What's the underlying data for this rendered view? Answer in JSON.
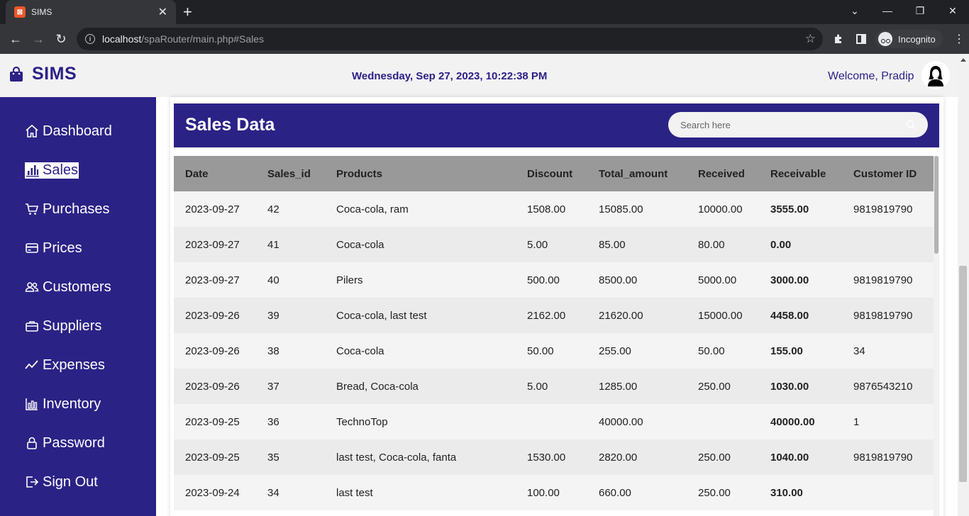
{
  "browser": {
    "tab_title": "SIMS",
    "url_host": "localhost",
    "url_path": "/spaRouter/main.php#Sales",
    "incognito_label": "Incognito"
  },
  "header": {
    "logo_text": "SIMS",
    "datetime": "Wednesday, Sep 27, 2023, 10:22:38 PM",
    "welcome": "Welcome, Pradip"
  },
  "sidebar": {
    "items": [
      {
        "label": "Dashboard",
        "icon": "home-icon"
      },
      {
        "label": "Sales",
        "icon": "bar-chart-icon"
      },
      {
        "label": "Purchases",
        "icon": "cart-icon"
      },
      {
        "label": "Prices",
        "icon": "credit-card-icon"
      },
      {
        "label": "Customers",
        "icon": "users-icon"
      },
      {
        "label": "Suppliers",
        "icon": "briefcase-icon"
      },
      {
        "label": "Expenses",
        "icon": "trend-line-icon"
      },
      {
        "label": "Inventory",
        "icon": "inventory-chart-icon"
      },
      {
        "label": "Password",
        "icon": "lock-icon"
      },
      {
        "label": "Sign Out",
        "icon": "sign-out-icon"
      }
    ]
  },
  "sales": {
    "title": "Sales Data",
    "search_placeholder": "Search here",
    "columns": [
      "Date",
      "Sales_id",
      "Products",
      "Discount",
      "Total_amount",
      "Received",
      "Receivable",
      "Customer ID"
    ],
    "rows": [
      [
        "2023-09-27",
        "42",
        "Coca-cola, ram",
        "1508.00",
        "15085.00",
        "10000.00",
        "3555.00",
        "9819819790"
      ],
      [
        "2023-09-27",
        "41",
        "Coca-cola",
        "5.00",
        "85.00",
        "80.00",
        "0.00",
        ""
      ],
      [
        "2023-09-27",
        "40",
        "Pilers",
        "500.00",
        "8500.00",
        "5000.00",
        "3000.00",
        "9819819790"
      ],
      [
        "2023-09-26",
        "39",
        "Coca-cola, last test",
        "2162.00",
        "21620.00",
        "15000.00",
        "4458.00",
        "9819819790"
      ],
      [
        "2023-09-26",
        "38",
        "Coca-cola",
        "50.00",
        "255.00",
        "50.00",
        "155.00",
        "34"
      ],
      [
        "2023-09-26",
        "37",
        "Bread, Coca-cola",
        "5.00",
        "1285.00",
        "250.00",
        "1030.00",
        "9876543210"
      ],
      [
        "2023-09-25",
        "36",
        "TechnoTop",
        "",
        "40000.00",
        "",
        "40000.00",
        "1"
      ],
      [
        "2023-09-25",
        "35",
        "last test, Coca-cola, fanta",
        "1530.00",
        "2820.00",
        "250.00",
        "1040.00",
        "9819819790"
      ],
      [
        "2023-09-24",
        "34",
        "last test",
        "100.00",
        "660.00",
        "250.00",
        "310.00",
        ""
      ]
    ]
  },
  "colors": {
    "brand": "#2b2286",
    "table_header": "#999999"
  }
}
